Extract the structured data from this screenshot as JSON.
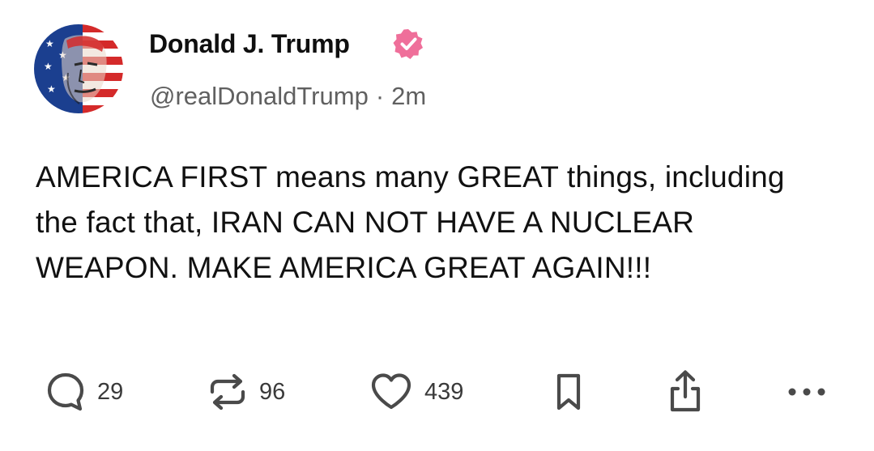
{
  "post": {
    "author": {
      "display_name": "Donald J. Trump",
      "handle": "@realDonaldTrump",
      "verified": true,
      "verified_badge_color": "#ef6f9a",
      "avatar_icon": "avatar-flag-portrait"
    },
    "separator": "·",
    "timestamp": "2m",
    "text": "AMERICA FIRST means many GREAT things, including the fact that, IRAN CAN NOT HAVE A NUCLEAR WEAPON. MAKE AMERICA GREAT AGAIN!!!"
  },
  "actions": {
    "reply": {
      "icon": "comment-bubble-icon",
      "count": "29"
    },
    "repost": {
      "icon": "repost-arrows-icon",
      "count": "96"
    },
    "like": {
      "icon": "heart-icon",
      "count": "439"
    },
    "bookmark": {
      "icon": "bookmark-icon"
    },
    "share": {
      "icon": "share-icon"
    },
    "more": {
      "icon": "more-dots-icon"
    }
  },
  "colors": {
    "text_primary": "#0f0f0f",
    "text_secondary": "#606060",
    "icon": "#4a4a4a",
    "background": "#ffffff"
  }
}
